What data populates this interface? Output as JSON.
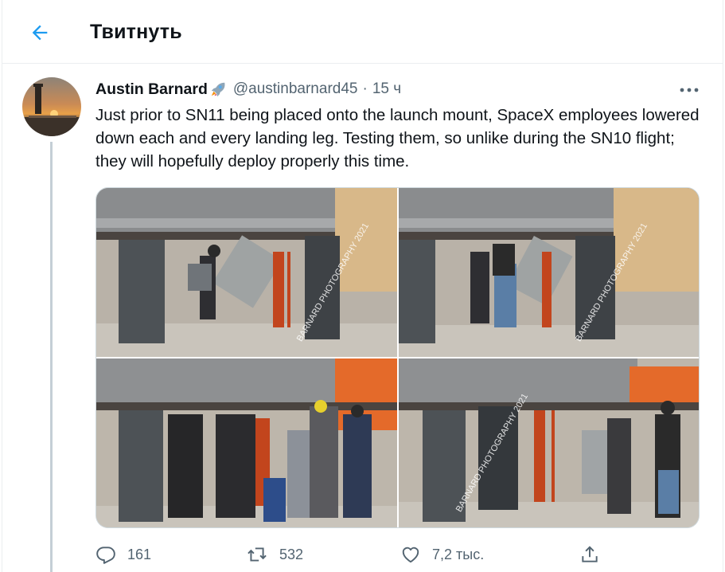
{
  "header": {
    "title": "Твитнуть"
  },
  "tweet": {
    "author_name": "Austin Barnard",
    "handle": "@austinbarnard45",
    "separator": "·",
    "time": "15 ч",
    "text": "Just prior to SN11 being placed onto the launch mount, SpaceX employees lowered down each and every landing leg. Testing them, so unlike during the SN10 flight; they will hopefully deploy properly this time.",
    "photos": [
      {
        "watermark": "BARNARD PHOTOGRAPHY 2021"
      },
      {
        "watermark": "BARNARD PHOTOGRAPHY 2021"
      },
      {
        "watermark": ""
      },
      {
        "watermark": "BARNARD PHOTOGRAPHY 2021"
      }
    ]
  },
  "actions": {
    "reply_count": "161",
    "retweet_count": "532",
    "like_count": "7,2 тыс."
  },
  "colors": {
    "accent": "#1d9bf0",
    "text_primary": "#0f1419",
    "text_secondary": "#536471",
    "divider": "#ebeef0"
  },
  "icons": {
    "back": "arrow-left-icon",
    "more": "more-dots-icon",
    "reply": "reply-bubble-icon",
    "retweet": "retweet-icon",
    "like": "heart-icon",
    "share": "share-upload-icon",
    "name_emoji": "rocket-emoji-icon"
  }
}
